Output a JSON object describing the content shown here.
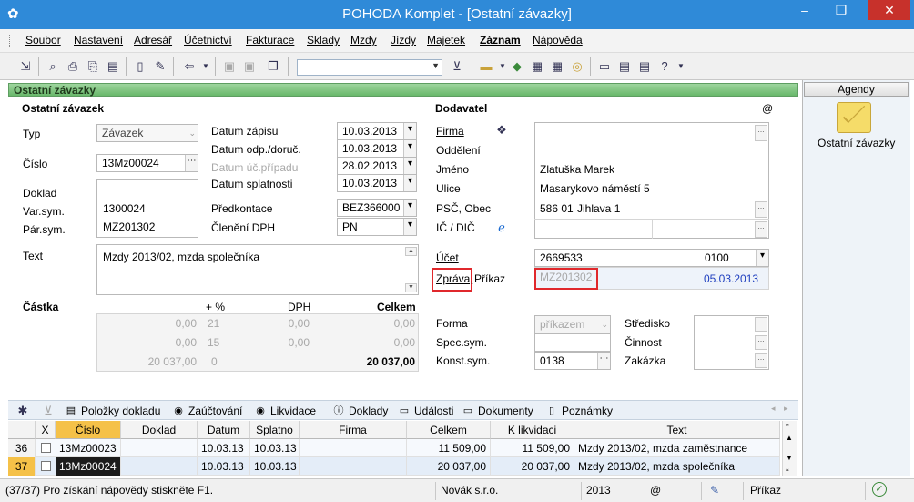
{
  "window": {
    "title": "POHODA Komplet - [Ostatní závazky]",
    "min_glyph": "–",
    "max_glyph": "❐",
    "close_glyph": "✕"
  },
  "menu": [
    "Soubor",
    "Nastavení",
    "Adresář",
    "Účetnictví",
    "Fakturace",
    "Sklady",
    "Mzdy",
    "Jízdy",
    "Majetek",
    "Záznam",
    "Nápověda"
  ],
  "toolbar": {
    "combo_value": ""
  },
  "section_title": "Ostatní závazky",
  "left": {
    "heading": "Ostatní závazek",
    "typ_label": "Typ",
    "typ_value": "Závazek",
    "cislo_label": "Číslo",
    "cislo_value": "13Mz00024",
    "doklad_label": "Doklad",
    "doklad_value": "",
    "varsym_label": "Var.sym.",
    "varsym_value": "1300024",
    "parsym_label": "Pár.sym.",
    "parsym_value": "MZ201302",
    "text_label": "Text",
    "text_value": "Mzdy 2013/02, mzda společníka",
    "castka_label": "Částka"
  },
  "dates": {
    "zapis_label": "Datum zápisu",
    "zapis": "10.03.2013",
    "odp_label": "Datum odp./doruč.",
    "odp": "10.03.2013",
    "ucpr_label": "Datum úč.případu",
    "ucpr": "28.02.2013",
    "splat_label": "Datum splatnosti",
    "splat": "10.03.2013",
    "predk_label": "Předkontace",
    "predk": "BEZ366000",
    "dph_label": "Členění DPH",
    "dph": "PN"
  },
  "amounts": {
    "headers": {
      "pct": "+ %",
      "dph": "DPH",
      "celkem": "Celkem"
    },
    "rows": [
      {
        "base": "0,00",
        "pct": "21",
        "dph": "0,00",
        "celkem": "0,00"
      },
      {
        "base": "0,00",
        "pct": "15",
        "dph": "0,00",
        "celkem": "0,00"
      },
      {
        "base": "20 037,00",
        "pct": "0",
        "dph": "",
        "celkem": "20 037,00"
      }
    ]
  },
  "supplier": {
    "heading": "Dodavatel",
    "at_sign": "@",
    "firma_label": "Firma",
    "firma": "",
    "oddeleni_label": "Oddělení",
    "oddeleni": "",
    "jmeno_label": "Jméno",
    "jmeno": "Zlatuška Marek",
    "ulice_label": "Ulice",
    "ulice": "Masarykovo náměstí 5",
    "psc_label": "PSČ, Obec",
    "psc": "586 01",
    "obec": "Jihlava 1",
    "ic_label": "IČ / DIČ",
    "ic": "",
    "dic": "",
    "ucet_label": "Účet",
    "ucet": "2669533",
    "kod_banky": "0100",
    "zprava_label": "Zpráva,",
    "prikaz_label": "Příkaz",
    "zprava": "MZ201302",
    "prikaz_date": "05.03.2013"
  },
  "payment": {
    "forma_label": "Forma",
    "forma": "příkazem",
    "specsym_label": "Spec.sym.",
    "specsym": "",
    "konstsym_label": "Konst.sym.",
    "konstsym": "0138",
    "stredisko_label": "Středisko",
    "cinnost_label": "Činnost",
    "zakazka_label": "Zakázka"
  },
  "tabs": [
    "Položky dokladu",
    "Zaúčtování",
    "Likvidace",
    "Doklady",
    "Události",
    "Dokumenty",
    "Poznámky"
  ],
  "grid": {
    "headers": [
      "",
      "X",
      "Číslo",
      "Doklad",
      "Datum",
      "Splatno",
      "Firma",
      "Celkem",
      "K likvidaci",
      "Text"
    ],
    "rows": [
      {
        "n": "36",
        "cislo": "13Mz00023",
        "doklad": "",
        "datum": "10.03.13",
        "splatno": "10.03.13",
        "firma": "",
        "celkem": "11 509,00",
        "likv": "11 509,00",
        "text": "Mzdy 2013/02, mzda zaměstnance"
      },
      {
        "n": "37",
        "cislo": "13Mz00024",
        "doklad": "",
        "datum": "10.03.13",
        "splatno": "10.03.13",
        "firma": "",
        "celkem": "20 037,00",
        "likv": "20 037,00",
        "text": "Mzdy 2013/02, mzda společníka"
      }
    ]
  },
  "status": {
    "hint": "(37/37) Pro získání nápovědy stiskněte F1.",
    "company": "Novák s.r.o.",
    "year": "2013",
    "at": "@",
    "mode": "Příkaz"
  },
  "agendy": {
    "title": "Agendy",
    "item": "Ostatní závazky"
  },
  "colors": {
    "titlebar": "#2f8ad8",
    "section": "#69b86b",
    "highlight": "#e0282c",
    "selected_row": "#1c1c1c",
    "blue_date": "#1f3fbf"
  }
}
